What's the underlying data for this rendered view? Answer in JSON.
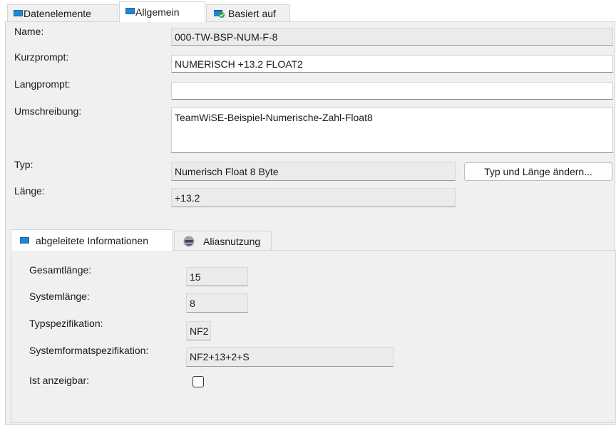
{
  "tabs": [
    {
      "label": "Datenelemente",
      "icon": "blue-rectangle-icon"
    },
    {
      "label": "Allgemein",
      "icon": "blue-rectangle-icon"
    },
    {
      "label": "Basiert auf",
      "icon": "database-check-icon"
    }
  ],
  "form": {
    "name_label": "Name:",
    "name_value": "000-TW-BSP-NUM-F-8",
    "kurzprompt_label": "Kurzprompt:",
    "kurzprompt_value": "NUMERISCH +13.2 FLOAT2",
    "langprompt_label": "Langprompt:",
    "langprompt_value": "",
    "umschreibung_label": "Umschreibung:",
    "umschreibung_value": "TeamWiSE-Beispiel-Numerische-Zahl-Float8",
    "typ_label": "Typ:",
    "typ_value": "Numerisch Float 8 Byte",
    "typ_button": "Typ und Länge ändern...",
    "laenge_label": "Länge:",
    "laenge_value": "+13.2"
  },
  "subtabs": [
    {
      "label": "abgeleitete Informationen",
      "icon": "blue-rectangle-icon"
    },
    {
      "label": "Aliasnutzung",
      "icon": "alias-mask-icon"
    }
  ],
  "derived": {
    "gesamtlaenge_label": "Gesamtlänge:",
    "gesamtlaenge_value": "15",
    "systemlaenge_label": "Systemlänge:",
    "systemlaenge_value": "8",
    "typspez_label": "Typspezifikation:",
    "typspez_value": "NF2",
    "sysformat_label": "Systemformatspezifikation:",
    "sysformat_value": "NF2+13+2+S",
    "anzeigbar_label": "Ist anzeigbar:",
    "anzeigbar_checked": false
  },
  "colors": {
    "accent_blue": "#1e88d4",
    "panel_bg": "#f0f0f0"
  }
}
